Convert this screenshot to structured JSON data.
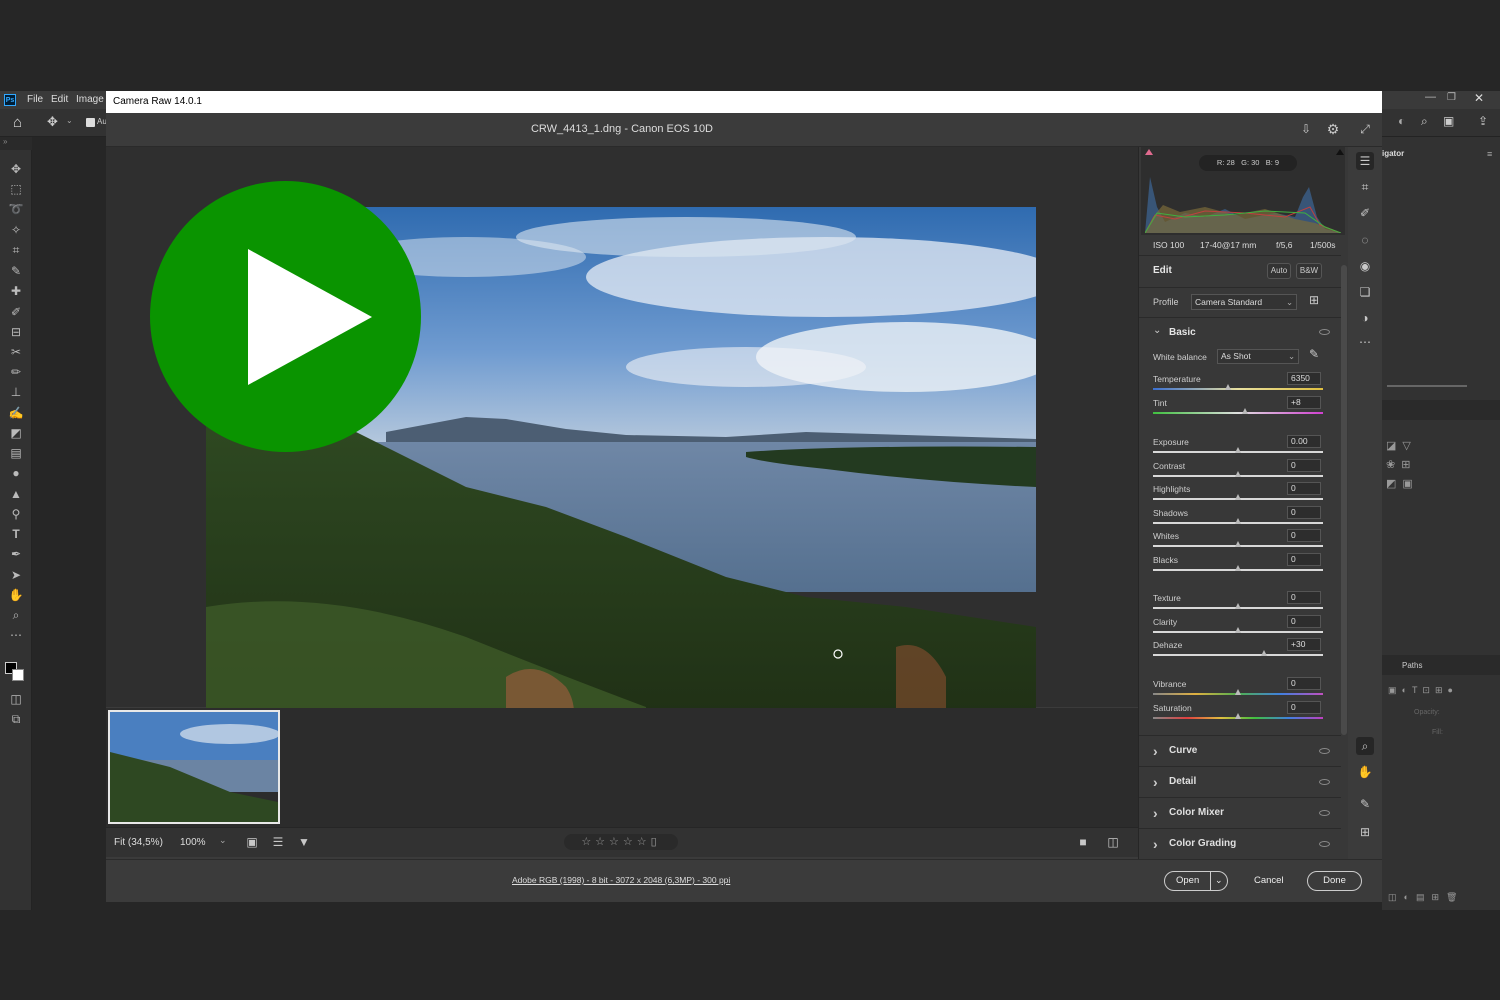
{
  "photoshop": {
    "app_icon": "Ps",
    "menu": [
      "File",
      "Edit",
      "Image"
    ],
    "options_checkbox_label": "Au",
    "navigator_label": "igator",
    "paths_label": "Paths",
    "opacity_label": "Opacity:",
    "fill_label": "Fill:"
  },
  "dialog": {
    "title": "Camera Raw 14.0.1",
    "file_title": "CRW_4413_1.dng  -  Canon EOS 10D"
  },
  "histogram": {
    "rgb_readout": {
      "r": "R: 28",
      "g": "G: 30",
      "b": "B: 9"
    }
  },
  "exif": {
    "iso": "ISO 100",
    "lens": "17-40@17 mm",
    "aperture": "f/5,6",
    "shutter": "1/500s"
  },
  "edit": {
    "title": "Edit",
    "auto_label": "Auto",
    "bw_label": "B&W",
    "profile_label": "Profile",
    "profile_value": "Camera Standard"
  },
  "basic": {
    "title": "Basic",
    "wb_label": "White balance",
    "wb_value": "As Shot",
    "sliders": [
      {
        "label": "Temperature",
        "value": "6350",
        "pos": 0.44
      },
      {
        "label": "Tint",
        "value": "+8",
        "pos": 0.54
      },
      {
        "label": "Exposure",
        "value": "0.00",
        "pos": 0.5
      },
      {
        "label": "Contrast",
        "value": "0",
        "pos": 0.5
      },
      {
        "label": "Highlights",
        "value": "0",
        "pos": 0.5
      },
      {
        "label": "Shadows",
        "value": "0",
        "pos": 0.5
      },
      {
        "label": "Whites",
        "value": "0",
        "pos": 0.5
      },
      {
        "label": "Blacks",
        "value": "0",
        "pos": 0.5
      },
      {
        "label": "Texture",
        "value": "0",
        "pos": 0.5
      },
      {
        "label": "Clarity",
        "value": "0",
        "pos": 0.5
      },
      {
        "label": "Dehaze",
        "value": "+30",
        "pos": 0.65
      },
      {
        "label": "Vibrance",
        "value": "0",
        "pos": 0.5
      },
      {
        "label": "Saturation",
        "value": "0",
        "pos": 0.5
      }
    ]
  },
  "sections": [
    "Curve",
    "Detail",
    "Color Mixer",
    "Color Grading"
  ],
  "view_bar": {
    "fit": "Fit (34,5%)",
    "zoom": "100%"
  },
  "footer": {
    "workflow": "Adobe RGB (1998) - 8 bit - 3072 x 2048 (6,3MP) - 300 ppi",
    "open": "Open",
    "cancel": "Cancel",
    "done": "Done"
  },
  "colors": {
    "play_button": "#0a9400",
    "accent": "#4a90d9"
  },
  "icons": [
    "home-icon",
    "move-icon",
    "export-icon",
    "gear-icon",
    "fullscreen-icon",
    "edit-sliders-icon",
    "crop-icon",
    "heal-icon",
    "mask-icon",
    "redeye-icon",
    "snapshots-icon",
    "presets-icon",
    "more-icon",
    "zoom-icon",
    "hand-icon",
    "sampler-icon",
    "grid-icon",
    "play-icon"
  ]
}
